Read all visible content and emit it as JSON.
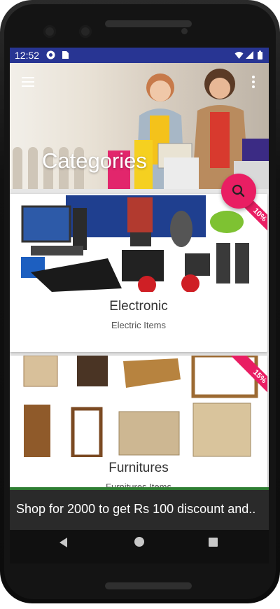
{
  "status_bar": {
    "time": "12:52"
  },
  "header": {
    "title": "Categories"
  },
  "fab": {
    "icon": "search-icon"
  },
  "categories": [
    {
      "name": "Electronic",
      "description": "Electric Items",
      "badge": "10%"
    },
    {
      "name": "Furnitures",
      "description": "Furnitures Items",
      "badge": "15%"
    }
  ],
  "snackbar": {
    "text": "Shop for 2000 to get Rs 100 discount and.."
  },
  "colors": {
    "status_bar": "#283593",
    "accent": "#e91e63",
    "snackbar": "#2a2a2a"
  }
}
